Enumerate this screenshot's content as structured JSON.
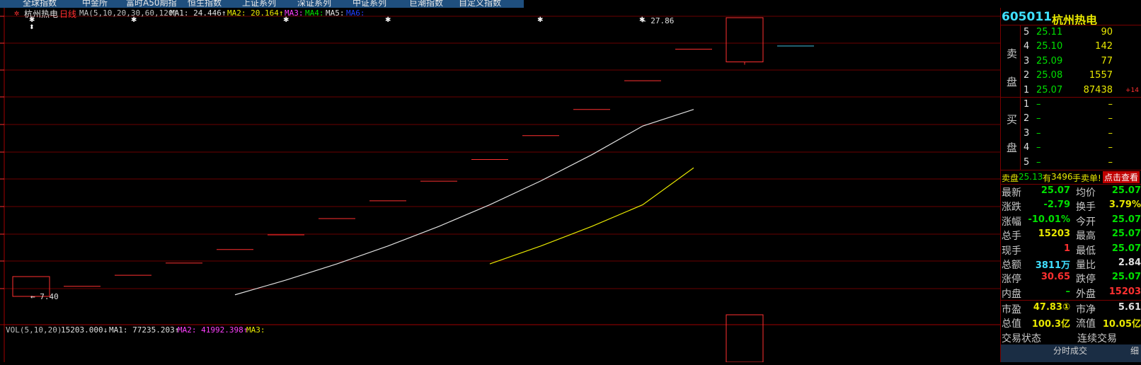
{
  "tabs": [
    "全球指数",
    "中金所",
    "富时A50期指",
    "恒生指数",
    "上证系列",
    "深证系列",
    "中证系列",
    "巨潮指数",
    "自定义指数"
  ],
  "chart": {
    "stock_name": "杭州热电",
    "period": "日线",
    "ma_label": "MA(5,10,20,30,60,120)",
    "ma1": "MA1: 24.446↑",
    "ma2": "MA2: 20.164↑",
    "ma3": "MA3:",
    "ma4": "MA4:",
    "ma5": "MA5:",
    "ma6": "MA6:",
    "high_annotation": "← 27.86",
    "low_annotation": "← 7.40",
    "vol_label": "VOL(5,10,20)",
    "vol_value": "15203.000↓",
    "vol_ma1": "MA1: 77235.203↑",
    "vol_ma2": "MA2: 41992.398↑",
    "vol_ma3": "MA3:",
    "colors": {
      "up": "#ff3030",
      "ma1": "#e0e0e0",
      "ma2": "#e8e800",
      "ma3": "#ff40ff",
      "ma4": "#00e000",
      "ma5": "#e0e0e0",
      "ma6": "#2040ff",
      "grid": "#6a0000"
    }
  },
  "chart_data": {
    "type": "candlestick",
    "daily_prices_last_to_first_board": [
      7.4,
      8.14,
      8.95,
      9.85,
      10.84,
      11.92,
      13.11,
      14.42,
      15.86,
      17.45,
      19.2,
      21.12,
      23.23,
      25.55,
      27.86,
      25.07
    ],
    "ma1_from_day5": [
      10.84,
      11.92,
      13.11,
      14.42,
      15.86,
      17.45,
      19.2,
      21.12,
      23.23,
      24.45
    ],
    "ma2_from_day10": [
      13.11,
      14.42,
      15.86,
      17.45,
      20.16
    ],
    "last_volume": 15203
  },
  "panel": {
    "code": "605011",
    "name": "杭州热电",
    "sell_label_1": "卖",
    "sell_label_2": "盘",
    "buy_label_1": "买",
    "buy_label_2": "盘",
    "sell": [
      {
        "n": "5",
        "price": "25.11",
        "vol": "90"
      },
      {
        "n": "4",
        "price": "25.10",
        "vol": "142"
      },
      {
        "n": "3",
        "price": "25.09",
        "vol": "77"
      },
      {
        "n": "2",
        "price": "25.08",
        "vol": "1557"
      },
      {
        "n": "1",
        "price": "25.07",
        "vol": "87438",
        "chg": "+14"
      }
    ],
    "buy": [
      {
        "n": "1",
        "price": "–",
        "vol": "–"
      },
      {
        "n": "2",
        "price": "–",
        "vol": "–"
      },
      {
        "n": "3",
        "price": "–",
        "vol": "–"
      },
      {
        "n": "4",
        "price": "–",
        "vol": "–"
      },
      {
        "n": "5",
        "price": "–",
        "vol": "–"
      }
    ],
    "notice_prefix": "卖盘",
    "notice_price": "25.13",
    "notice_mid": "有",
    "notice_qty": "3496",
    "notice_suffix": "手卖单!",
    "notice_button": "点击查看",
    "stats": [
      {
        "l1": "最新",
        "v1": "25.07",
        "c1": "#00e000",
        "l2": "均价",
        "v2": "25.07",
        "c2": "#00e000"
      },
      {
        "l1": "涨跌",
        "v1": "-2.79",
        "c1": "#00e000",
        "l2": "换手",
        "v2": "3.79%",
        "c2": "#e8e800"
      },
      {
        "l1": "涨幅",
        "v1": "-10.01%",
        "c1": "#00e000",
        "l2": "今开",
        "v2": "25.07",
        "c2": "#00e000"
      },
      {
        "l1": "总手",
        "v1": "15203",
        "c1": "#e8e800",
        "l2": "最高",
        "v2": "25.07",
        "c2": "#00e000"
      },
      {
        "l1": "现手",
        "v1": "1",
        "c1": "#ff3030",
        "l2": "最低",
        "v2": "25.07",
        "c2": "#00e000"
      },
      {
        "l1": "总额",
        "v1": "3811万",
        "c1": "#40e0ff",
        "l2": "量比",
        "v2": "2.84",
        "c2": "#e0e0e0"
      },
      {
        "l1": "涨停",
        "v1": "30.65",
        "c1": "#ff3030",
        "l2": "跌停",
        "v2": "25.07",
        "c2": "#00e000"
      },
      {
        "l1": "内盘",
        "v1": "–",
        "c1": "#00e000",
        "l2": "外盘",
        "v2": "15203",
        "c2": "#ff3030"
      }
    ],
    "stats2": [
      {
        "l1": "市盈",
        "v1": "47.83①",
        "c1": "#e8e800",
        "l2": "市净",
        "v2": "5.61",
        "c2": "#e0e0e0"
      },
      {
        "l1": "总值",
        "v1": "100.3亿",
        "c1": "#e8e800",
        "l2": "流值",
        "v2": "10.05亿",
        "c2": "#e8e800"
      }
    ],
    "status_label": "交易状态",
    "status_value": "连续交易",
    "bottom_tab": "分时成交",
    "bottom_tab2": "细"
  }
}
